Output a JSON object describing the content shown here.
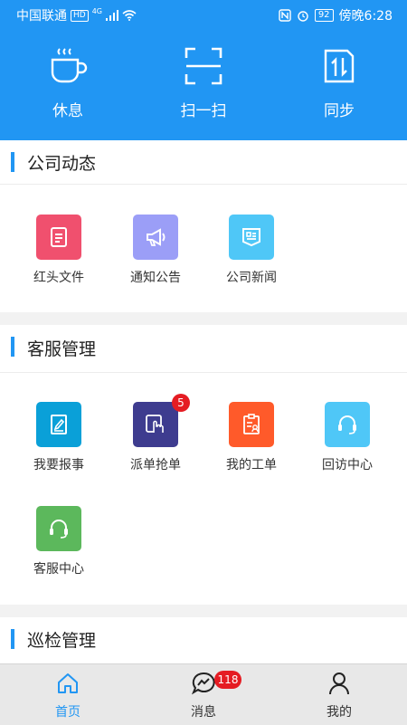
{
  "status_bar": {
    "carrier": "中国联通",
    "hd": "HD",
    "network": "4G",
    "battery": "92",
    "time": "傍晚6:28"
  },
  "quick_actions": [
    {
      "label": "休息",
      "icon": "coffee-cup-icon"
    },
    {
      "label": "扫一扫",
      "icon": "scan-icon"
    },
    {
      "label": "同步",
      "icon": "sync-icon"
    }
  ],
  "sections": {
    "company_news": {
      "title": "公司动态",
      "items": [
        {
          "label": "红头文件",
          "icon": "document-icon",
          "color": "#f0506e"
        },
        {
          "label": "通知公告",
          "icon": "megaphone-icon",
          "color": "#9b9ef7"
        },
        {
          "label": "公司新闻",
          "icon": "newspaper-icon",
          "color": "#4fc7f7"
        }
      ]
    },
    "customer_service": {
      "title": "客服管理",
      "items": [
        {
          "label": "我要报事",
          "icon": "report-icon",
          "color": "#0aa0d8"
        },
        {
          "label": "派单抢单",
          "icon": "tap-order-icon",
          "color": "#3e3c8f",
          "badge": "5"
        },
        {
          "label": "我的工单",
          "icon": "work-order-icon",
          "color": "#ff5a2a"
        },
        {
          "label": "回访中心",
          "icon": "headset-icon",
          "color": "#4fc7f7"
        },
        {
          "label": "客服中心",
          "icon": "headset-icon",
          "color": "#5cb85c"
        }
      ]
    },
    "patrol": {
      "title": "巡检管理"
    }
  },
  "tabbar": [
    {
      "label": "首页",
      "icon": "home-icon",
      "active": true
    },
    {
      "label": "消息",
      "icon": "message-icon",
      "badge": "118"
    },
    {
      "label": "我的",
      "icon": "person-icon"
    }
  ],
  "colors": {
    "primary": "#2196f3",
    "badge": "#e51c23"
  }
}
